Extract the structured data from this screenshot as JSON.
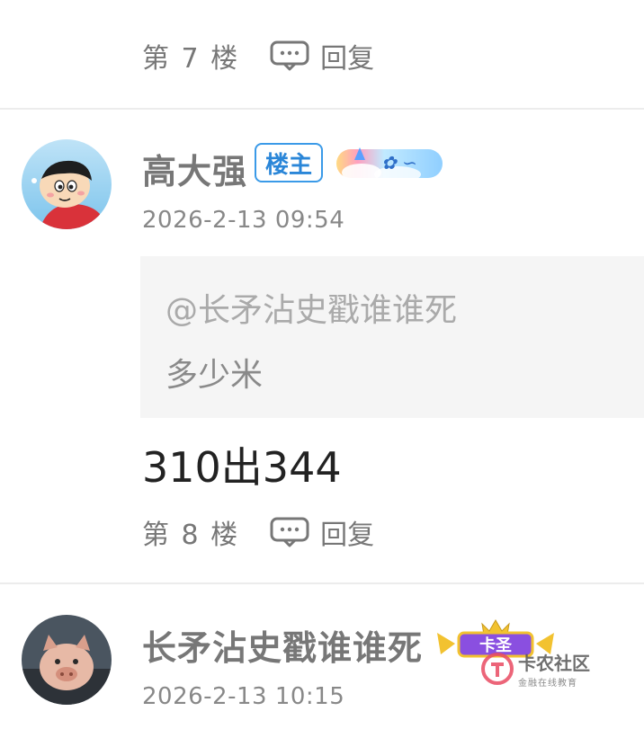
{
  "prev_post": {
    "floor_label": "第 7 楼",
    "reply_label": "回复"
  },
  "post": {
    "username": "高大强",
    "owner_badge": "楼主",
    "timestamp": "2026-2-13 09:54",
    "quote_mention": "@长矛沾史戳谁谁死",
    "quote_text": "多少米",
    "content": "310出344",
    "floor_label": "第 8 楼",
    "reply_label": "回复",
    "avatar_icon": "cartoon-boy-avatar",
    "medal_icon": "cloud-medal-badge"
  },
  "next_post": {
    "username": "长矛沾史戳谁谁死",
    "timestamp": "2026-2-13 10:15",
    "avatar_icon": "pig-avatar",
    "medal_label": "卡圣",
    "medal_icon": "crown-medal-badge"
  },
  "watermark": {
    "title": "卡农社区",
    "subtitle": "金融在线教育"
  },
  "colors": {
    "owner_badge": "#2a86d8",
    "medal_purple": "#8a4fe0",
    "medal_gold": "#f2c230"
  }
}
